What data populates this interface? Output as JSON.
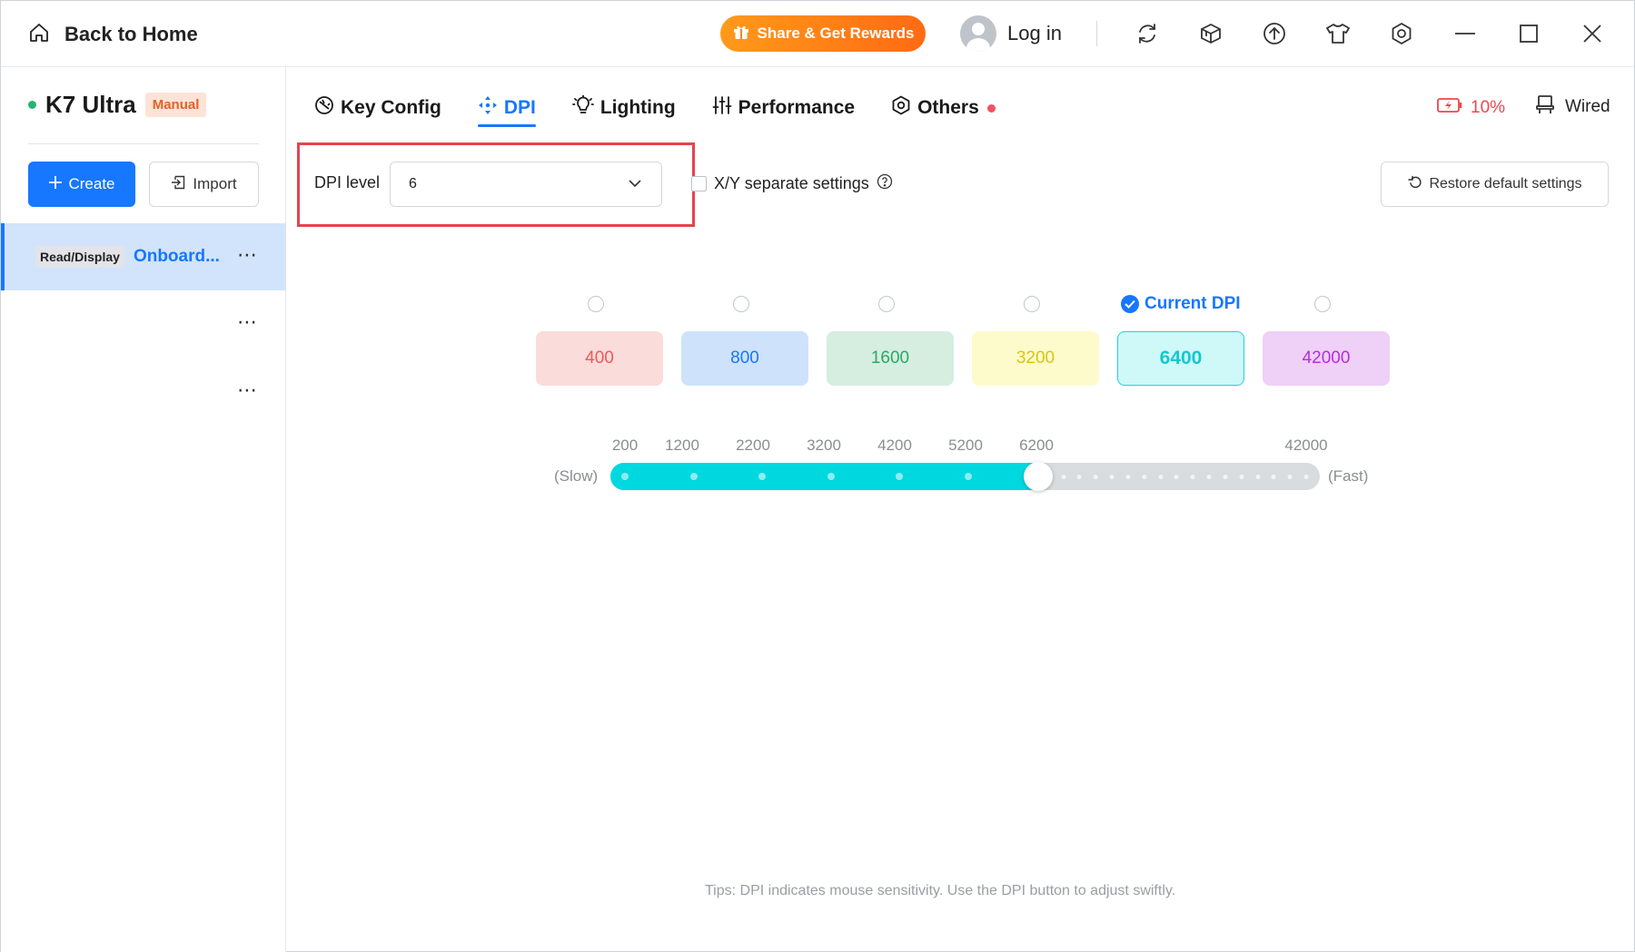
{
  "titlebar": {
    "home_label": "Back to Home",
    "share_label": "Share & Get Rewards",
    "login_label": "Log in",
    "icons": [
      "refresh-icon",
      "cube-icon",
      "upload-icon",
      "tshirt-icon",
      "settings-hex-icon",
      "minimize-icon",
      "maximize-icon",
      "close-icon"
    ]
  },
  "sidebar": {
    "device_name": "K7 Ultra",
    "device_badge": "Manual",
    "create_label": "Create",
    "import_label": "Import",
    "profiles": [
      {
        "tag": "Read/Display",
        "name": "Onboard...",
        "more": "⋯",
        "active": true
      },
      {
        "tag": "",
        "name": "",
        "more": "⋯",
        "active": false
      },
      {
        "tag": "",
        "name": "",
        "more": "⋯",
        "active": false
      }
    ]
  },
  "tabs": [
    {
      "label": "Key Config",
      "icon": "key-config-icon"
    },
    {
      "label": "DPI",
      "icon": "dpi-icon",
      "active": true
    },
    {
      "label": "Lighting",
      "icon": "lightbulb-icon"
    },
    {
      "label": "Performance",
      "icon": "sliders-icon"
    },
    {
      "label": "Others",
      "icon": "settings-hex-icon",
      "notification": true
    }
  ],
  "status": {
    "battery": "10%",
    "connection": "Wired"
  },
  "dpi": {
    "level_label": "DPI level",
    "level_value": "6",
    "xy_label": "X/Y separate settings",
    "restore_label": "Restore default settings",
    "current_label": "Current DPI",
    "current_index": 4,
    "stages": [
      {
        "value": "400",
        "bg": "#fadcda",
        "fg": "#f0585c"
      },
      {
        "value": "800",
        "bg": "#cfe2fc",
        "fg": "#1677ff"
      },
      {
        "value": "1600",
        "bg": "#d5eee0",
        "fg": "#2aa866"
      },
      {
        "value": "3200",
        "bg": "#fdfbcc",
        "fg": "#d9c60f"
      },
      {
        "value": "6400",
        "bg": "#cff8f8",
        "fg": "#11c9cf"
      },
      {
        "value": "42000",
        "bg": "#efd0f6",
        "fg": "#b52fd8"
      }
    ],
    "slider": {
      "ticks": [
        "200",
        "1200",
        "2200",
        "3200",
        "4200",
        "5200",
        "6200",
        "42000"
      ],
      "slow_label": "(Slow)",
      "fast_label": "(Fast)",
      "min": 200,
      "max": 42000,
      "value": 6400
    },
    "tips": "Tips: DPI indicates mouse sensitivity. Use the DPI button to adjust swiftly."
  }
}
